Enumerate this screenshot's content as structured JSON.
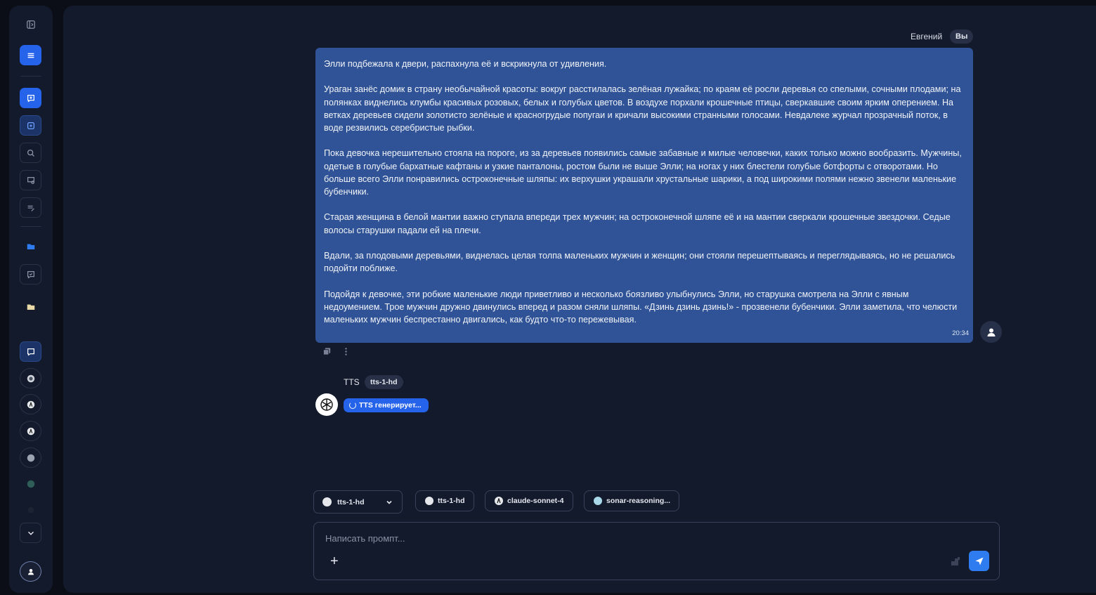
{
  "header": {
    "user_name": "Евгений",
    "you_badge": "Вы"
  },
  "message": {
    "paragraphs": [
      "Элли подбежала к двери, распахнула её и вскрикнула от удивления.",
      "Ураган занёс домик в страну необычайной красоты: вокруг расстилалась зелёная лужайка; по краям её росли деревья со спелыми, сочными плодами; на полянках виднелись клумбы красивых розовых, белых и голубых цветов. В воздухе порхали крошечные птицы, сверкавшие своим ярким оперением. На ветках деревьев сидели золотисто зелёные и красногрудые попугаи и кричали высокими странными голосами. Невдалеке журчал прозрачный поток, в воде резвились серебристые рыбки.",
      "Пока девочка нерешительно стояла на пороге, из за деревьев появились самые забавные и милые человечки, каких только можно вообразить. Мужчины, одетые в голубые бархатные кафтаны и узкие панталоны, ростом были не выше Элли; на ногах у них блестели голубые ботфорты с отворотами. Но больше всего Элли понравились остроконечные шляпы: их верхушки украшали хрустальные шарики, а под широкими полями нежно звенели маленькие бубенчики.",
      "Старая женщина в белой мантии важно ступала впереди трех мужчин; на остроконечной шляпе её и на мантии сверкали крошечные звездочки. Седые волосы старушки падали ей на плечи.",
      "Вдали, за плодовыми деревьями, виднелась целая толпа маленьких мужчин и женщин; они стояли перешептываясь и переглядываясь, но не решались подойти поближе.",
      "Подойдя к девочке, эти робкие маленькие люди приветливо и несколько боязливо улыбнулись Элли, но старушка смотрела на Элли с явным недоумением. Трое мужчин дружно двинулись вперед и разом сняли шляпы. «Дзинь дзинь дзинь!» - прозвенели бубенчики. Элли заметила, что челюсти маленьких мужчин беспрестанно двигались, как будто что-то пережевывая."
    ],
    "time": "20:34"
  },
  "bot": {
    "name": "TTS",
    "model_badge": "tts-1-hd",
    "status": "TTS генерирует..."
  },
  "models": {
    "selected": "tts-1-hd",
    "chips": [
      "tts-1-hd",
      "claude-sonnet-4",
      "sonar-reasoning..."
    ]
  },
  "composer": {
    "placeholder": "Написать промпт..."
  },
  "colors": {
    "accent": "#2563eb",
    "bubble": "#2f5396",
    "panel": "#131a2b",
    "background": "#0b0d17"
  }
}
